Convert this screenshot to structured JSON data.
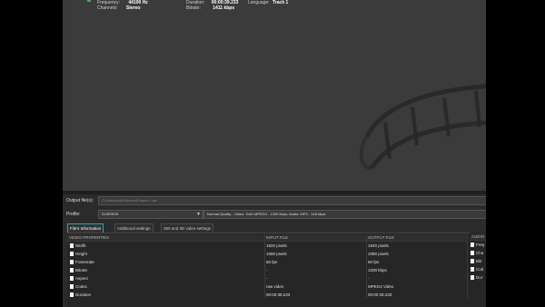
{
  "media_info": {
    "frequency_label": "Frequency:",
    "frequency_value": "44100 Hz",
    "channels_label": "Channels:",
    "channels_value": "Stereo",
    "duration_label": "Duration:",
    "duration_value": "00:00:39.233",
    "bitrate_label": "Bitrate:",
    "bitrate_value": "1411 kbps",
    "language_label": "Language:",
    "language_value": "Track 1"
  },
  "output": {
    "label": "Output file(s):",
    "path": "C:\\Users\\AAA\\Videos\\Project 1.avi"
  },
  "profile": {
    "label": "Profile:",
    "category": "Common",
    "preset": "Normal Quality - Video: XviD MPEG4 - 1200 kbps; Audio: MP3 - 128 kbps"
  },
  "tabs": [
    {
      "label": "File's Information",
      "active": true
    },
    {
      "label": "Additional settings",
      "active": false
    },
    {
      "label": "360 and 3D video settings",
      "active": false
    }
  ],
  "video_table": {
    "headers": [
      "VIDEO PROPERTIES",
      "INPUT FILE",
      "OUTPUT FILE"
    ],
    "rows": [
      {
        "prop": "Width",
        "input": "1920 pixels",
        "output": "1920 pixels"
      },
      {
        "prop": "Height",
        "input": "1080 pixels",
        "output": "1080 pixels"
      },
      {
        "prop": "Framerate",
        "input": "60 fps",
        "output": "60 fps"
      },
      {
        "prop": "Bitrate",
        "input": "-",
        "output": "1200 kbps"
      },
      {
        "prop": "Aspect",
        "input": "-",
        "output": "-"
      },
      {
        "prop": "Codec",
        "input": "raw video",
        "output": "MPEG4 Video"
      },
      {
        "prop": "Duration",
        "input": "00:00:39.233",
        "output": "00:00:39.233"
      }
    ]
  },
  "audio_table": {
    "header": "AUDIO",
    "rows": [
      "Freq",
      "Cha",
      "Bitr",
      "Cod",
      "Dur"
    ]
  },
  "colors": {
    "accent": "#2fa3a8",
    "background": "#2b2b2b"
  }
}
